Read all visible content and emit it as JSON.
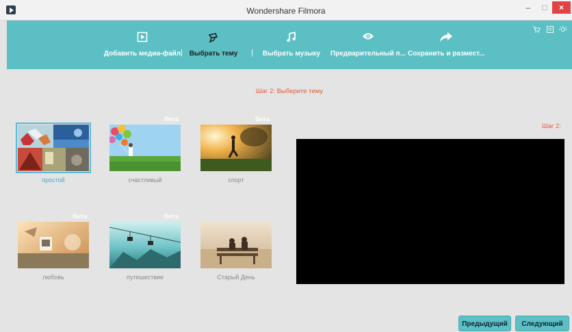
{
  "window": {
    "title": "Wondershare Filmora",
    "min": "–",
    "max": "□",
    "close": "×"
  },
  "toolbar": {
    "items": [
      {
        "label": "Добавить медиа-файл",
        "icon": "media-icon"
      },
      {
        "label": "Выбрать тему",
        "icon": "theme-icon"
      },
      {
        "label": "Выбрать музыку",
        "icon": "music-icon"
      },
      {
        "label": "Предварительный п...",
        "icon": "eye-icon"
      },
      {
        "label": "Сохранить и размест...",
        "icon": "share-icon"
      }
    ],
    "sep1": "|",
    "sep2": "|",
    "right_icons": [
      "cart-icon",
      "list-icon",
      "bulb-icon"
    ]
  },
  "step": {
    "title": "Шаг 2: Выберите тему",
    "right_label": "Шаг 2:"
  },
  "themes": [
    {
      "name": "простой",
      "badge": ""
    },
    {
      "name": "счастливый",
      "badge": "бета"
    },
    {
      "name": "спорт",
      "badge": "бета"
    },
    {
      "name": "любовь",
      "badge": "бета"
    },
    {
      "name": "путешествие",
      "badge": "бета"
    },
    {
      "name": "Старый День",
      "badge": ""
    }
  ],
  "selected_theme": "простой",
  "buttons": {
    "prev": "Предыдущий",
    "next": "Следующий"
  },
  "colors": {
    "accent": "#5bbfc4",
    "step": "#e05a3c",
    "selected": "#4aa6d6"
  }
}
